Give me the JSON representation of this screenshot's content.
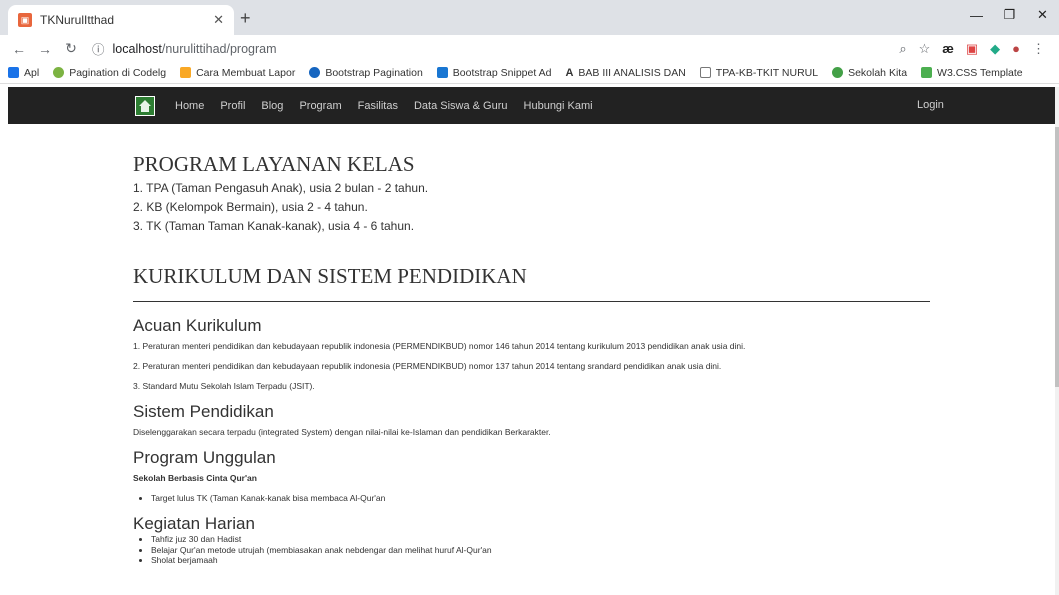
{
  "browser": {
    "tab_title": "TKNurulItthad",
    "url_host": "localhost",
    "url_path": "/nurulittihad/program",
    "bookmarks": [
      "Apl",
      "Pagination di Codelg",
      "Cara Membuat Lapor",
      "Bootstrap Pagination",
      "Bootstrap Snippet Ad",
      "BAB III ANALISIS DAN",
      "TPA-KB-TKIT NURUL",
      "Sekolah Kita",
      "W3.CSS Template"
    ]
  },
  "navbar": {
    "links": [
      "Home",
      "Profil",
      "Blog",
      "Program",
      "Fasilitas",
      "Data Siswa & Guru",
      "Hubungi Kami"
    ],
    "login": "Login"
  },
  "program": {
    "title": "PROGRAM LAYANAN KELAS",
    "items": [
      "1. TPA (Taman Pengasuh Anak), usia 2 bulan - 2 tahun.",
      "2. KB (Kelompok Bermain), usia 2 - 4 tahun.",
      "3. TK (Taman Taman Kanak-kanak), usia 4 - 6 tahun."
    ]
  },
  "kurikulum": {
    "title": "KURIKULUM DAN SISTEM PENDIDIKAN",
    "acuan_title": "Acuan Kurikulum",
    "acuan_items": [
      "1. Peraturan menteri pendidikan dan kebudayaan republik indonesia (PERMENDIKBUD) nomor 146 tahun 2014 tentang kurikulum 2013 pendidikan anak usia dini.",
      "2. Peraturan menteri pendidikan dan kebudayaan republik indonesia (PERMENDIKBUD) nomor 137 tahun 2014 tentang srandard pendidikan anak usia dini.",
      "3. Standard Mutu Sekolah Islam Terpadu (JSIT)."
    ],
    "sistem_title": "Sistem Pendidikan",
    "sistem_text": "Diselenggarakan secara terpadu (integrated System) dengan nilai-nilai ke-Islaman dan pendidikan Berkarakter.",
    "unggulan_title": "Program Unggulan",
    "unggulan_sub": "Sekolah Berbasis Cinta Qur'an",
    "unggulan_items": [
      "Target lulus TK (Taman Kanak-kanak bisa membaca Al-Qur'an"
    ],
    "harian_title": "Kegiatan Harian",
    "harian_items": [
      "Tahfiz juz 30 dan Hadist",
      "Belajar Qur'an metode utrujah (membiasakan anak nebdengar dan melihat huruf Al-Qur'an",
      "Sholat berjamaah"
    ]
  }
}
